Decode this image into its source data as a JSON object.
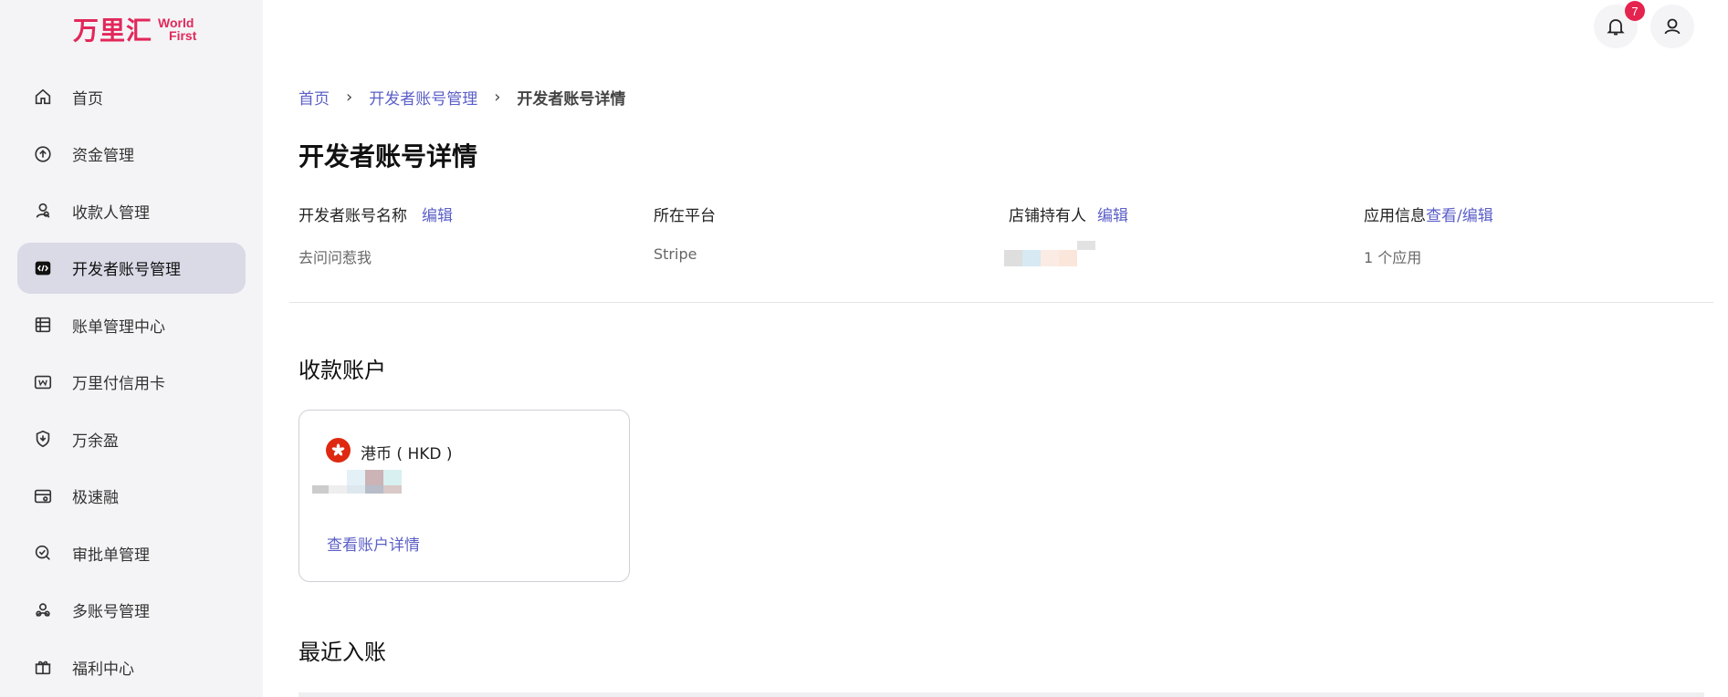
{
  "brand": {
    "logo_cn": "万里汇",
    "logo_en_line1": "World",
    "logo_en_line2": "First"
  },
  "sidebar": {
    "items": [
      {
        "label": "首页",
        "icon": "home-icon",
        "active": false
      },
      {
        "label": "资金管理",
        "icon": "arrow-up-circle-icon",
        "active": false
      },
      {
        "label": "收款人管理",
        "icon": "payee-icon",
        "active": false
      },
      {
        "label": "开发者账号管理",
        "icon": "code-icon",
        "active": true
      },
      {
        "label": "账单管理中心",
        "icon": "bill-icon",
        "active": false
      },
      {
        "label": "万里付信用卡",
        "icon": "card-w-icon",
        "active": false
      },
      {
        "label": "万余盈",
        "icon": "shield-icon",
        "active": false
      },
      {
        "label": "极速融",
        "icon": "finance-icon",
        "active": false
      },
      {
        "label": "审批单管理",
        "icon": "approval-icon",
        "active": false
      },
      {
        "label": "多账号管理",
        "icon": "multi-account-icon",
        "active": false
      },
      {
        "label": "福利中心",
        "icon": "gift-icon",
        "active": false
      }
    ]
  },
  "header": {
    "notification_count": "7"
  },
  "breadcrumb": {
    "home": "首页",
    "parent": "开发者账号管理",
    "current": "开发者账号详情"
  },
  "page": {
    "title": "开发者账号详情"
  },
  "info": {
    "account_name_label": "开发者账号名称",
    "account_name_edit": "编辑",
    "account_name_value": "去问问惹我",
    "platform_label": "所在平台",
    "platform_value": "Stripe",
    "store_owner_label": "店铺持有人",
    "store_owner_edit": "编辑",
    "app_info_label": "应用信息",
    "app_info_action": "查看/编辑",
    "app_info_value": "1 个应用"
  },
  "receiving_accounts": {
    "title": "收款账户",
    "card": {
      "currency": "港币 ( HKD )",
      "link": "查看账户详情"
    }
  },
  "recent": {
    "title": "最近入账"
  },
  "colors": {
    "brand": "#e2285a",
    "link": "#5b5fc7",
    "active_nav_bg": "#d9dae6",
    "badge": "#e5234f"
  }
}
